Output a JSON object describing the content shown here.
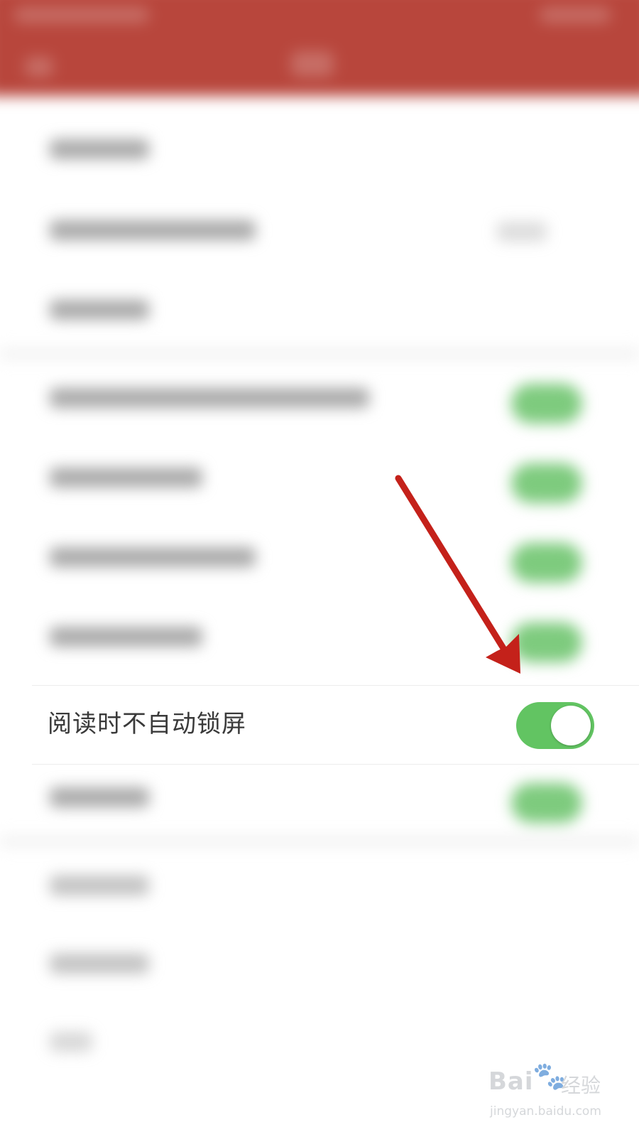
{
  "settings": {
    "highlighted_item": {
      "label": "阅读时不自动锁屏",
      "toggle_on": true
    }
  },
  "colors": {
    "header": "#b8463c",
    "toggle_on": "#62c462",
    "annotation_arrow": "#c4211a"
  },
  "watermark": {
    "brand": "Bai",
    "brand_icon": "paw-icon",
    "cn": "经验",
    "url": "jingyan.baidu.com"
  }
}
